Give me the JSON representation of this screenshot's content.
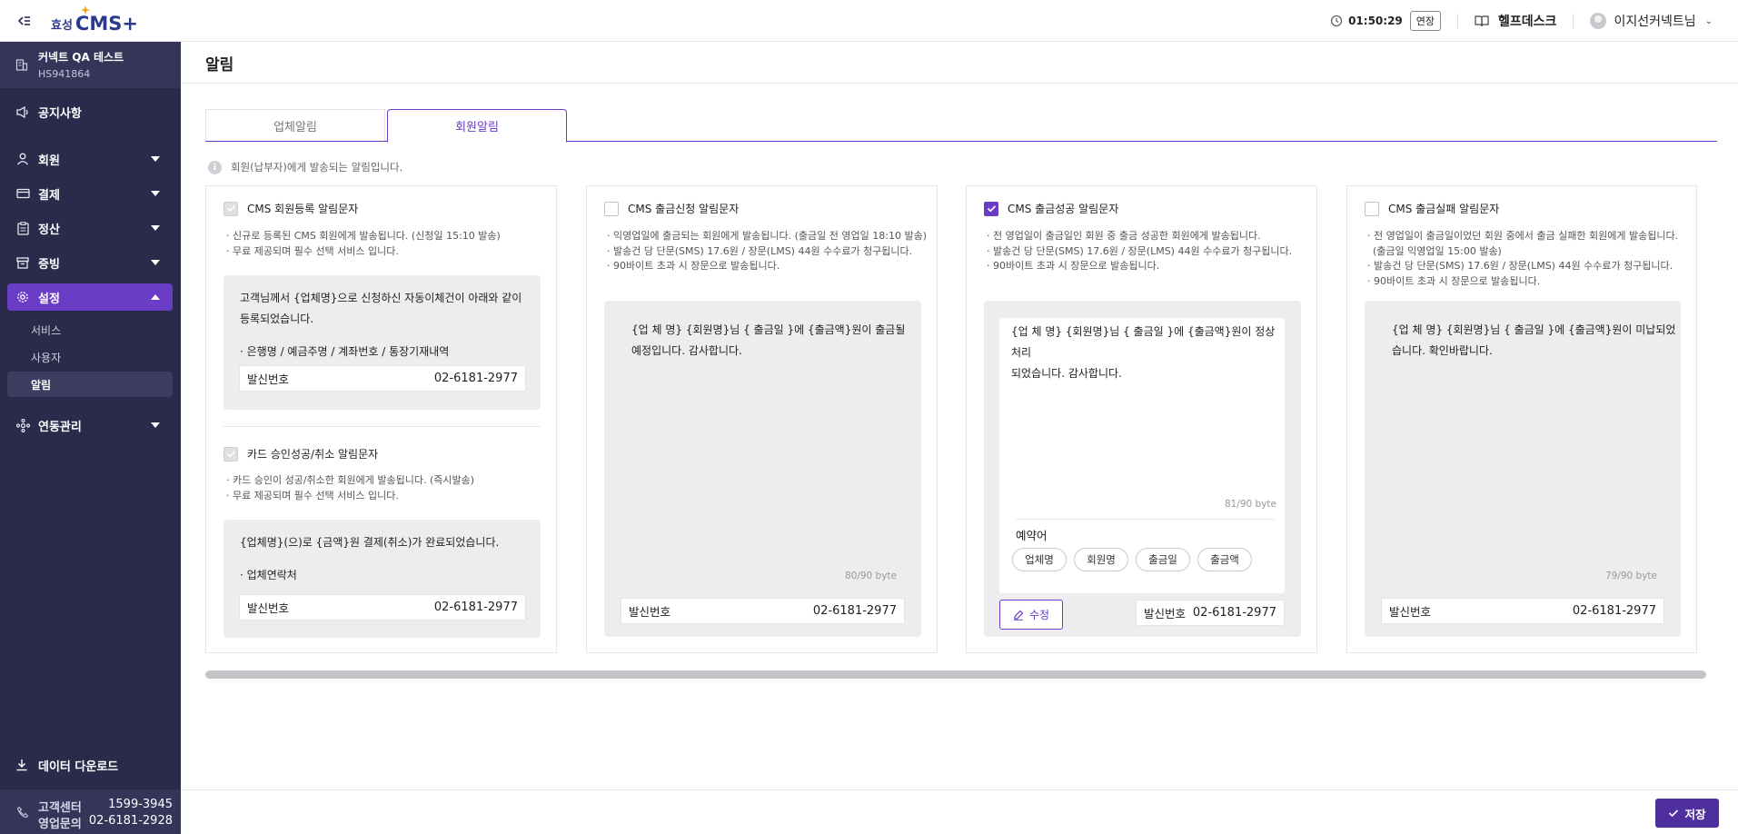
{
  "header": {
    "logo_small": "효성",
    "logo_big": "CMS+",
    "timer": "01:50:29",
    "extend_label": "연장",
    "help_label": "헬프데스크",
    "user_name": "이지선커넥트님"
  },
  "sidebar": {
    "company_name": "커넥트 QA 테스트",
    "company_code": "HS941864",
    "items": [
      {
        "label": "공지사항",
        "icon": "megaphone-icon"
      },
      {
        "label": "회원",
        "icon": "person-icon"
      },
      {
        "label": "결제",
        "icon": "card-icon"
      },
      {
        "label": "정산",
        "icon": "clipboard-icon"
      },
      {
        "label": "증빙",
        "icon": "archive-icon"
      },
      {
        "label": "설정",
        "icon": "gear-icon"
      },
      {
        "label": "연동관리",
        "icon": "link-icon"
      }
    ],
    "sub_items": [
      "서비스",
      "사용자",
      "알림"
    ],
    "download_label": "데이터 다운로드",
    "support": {
      "center_label": "고객센터",
      "center_phone": "1599-3945",
      "sales_label": "영업문의",
      "sales_phone": "02-6181-2928"
    }
  },
  "page": {
    "title": "알림",
    "tabs": [
      "업체알림",
      "회원알림"
    ],
    "notice": "회원(납부자)에게 발송되는 알림입니다."
  },
  "cards": {
    "c1": {
      "opt1_label": "CMS 회원등록 알림문자",
      "opt1_desc1": "· 신규로 등록된 CMS 회원에게 발송됩니다. (신청일 15:10 발송)",
      "opt1_desc2": "· 무료 제공되며 필수 선택 서비스 입니다.",
      "msg1_line1": "고객님께서 {업체명}으로 신청하신 자동이체건이 아래와 같이",
      "msg1_line2": "등록되었습니다.",
      "msg1_line3": "· 은행명 / 예금주명 / 계좌번호 / 통장기재내역",
      "sender_label": "발신번호",
      "sender_number": "02-6181-2977",
      "opt2_label": "카드 승인성공/취소 알림문자",
      "opt2_desc1": "· 카드 승인이 성공/취소한 회원에게 발송됩니다. (즉시발송)",
      "opt2_desc2": "· 무료 제공되며 필수 선택 서비스 입니다.",
      "msg2_line1": "{업체명}(으)로 {금액}원 결제(취소)가 완료되었습니다.",
      "msg2_line2": "· 업체연락처"
    },
    "c2": {
      "label": "CMS 출금신청 알림문자",
      "desc1": "· 익영업일에 출금되는 회원에게 발송됩니다. (출금일 전 영업일 18:10 발송)",
      "desc2": "· 발송건 당 단문(SMS) 17.6원 / 장문(LMS) 44원 수수료가 청구됩니다.",
      "desc3": "· 90바이트 초과 시 장문으로 발송됩니다.",
      "msg_line1": "{업 체 명} {회원명}님 { 출금일 }에 {출금액}원이 출금될",
      "msg_line2": "예정입니다. 감사합니다.",
      "bytes": "80/90 byte",
      "sender_label": "발신번호",
      "sender_number": "02-6181-2977"
    },
    "c3": {
      "label": "CMS 출금성공 알림문자",
      "desc1": "· 전 영업일이 출금일인 회원 중 출금 성공한 회원에게 발송됩니다.",
      "desc2": "· 발송건 당 단문(SMS) 17.6원 / 장문(LMS) 44원 수수료가 청구됩니다.",
      "desc3": "· 90바이트 초과 시 장문으로 발송됩니다.",
      "msg_line1": "{업 체 명} {회원명}님 { 출금일 }에 {출금액}원이 정상처리",
      "msg_line2": "되었습니다. 감사합니다.",
      "bytes": "81/90 byte",
      "reserved_title": "예약어",
      "chips": [
        "업체명",
        "회원명",
        "출금일",
        "출금액"
      ],
      "edit_label": "수정",
      "sender_label": "발신번호",
      "sender_number": "02-6181-2977"
    },
    "c4": {
      "label": "CMS 출금실패 알림문자",
      "desc1": "· 전 영업일이 출금일이었던 회원 중에서 출금 실패한 회원에게 발송됩니다.",
      "desc1b": "(출금일 익영업일 15:00 발송)",
      "desc2": "· 발송건 당 단문(SMS) 17.6원 / 장문(LMS) 44원 수수료가 청구됩니다.",
      "desc3": "· 90바이트 초과 시 장문으로 발송됩니다.",
      "msg_line1": "{업 체 명} {회원명}님 { 출금일 }에 {출금액}원이 미납되었",
      "msg_line2": "습니다. 확인바랍니다.",
      "bytes": "79/90 byte",
      "sender_label": "발신번호",
      "sender_number": "02-6181-2977"
    }
  },
  "footer": {
    "save_label": "저장"
  },
  "colors": {
    "sidebar_bg": "#2a2a4a",
    "accent": "#6a3dc6",
    "save_button": "#4f2f9e"
  }
}
